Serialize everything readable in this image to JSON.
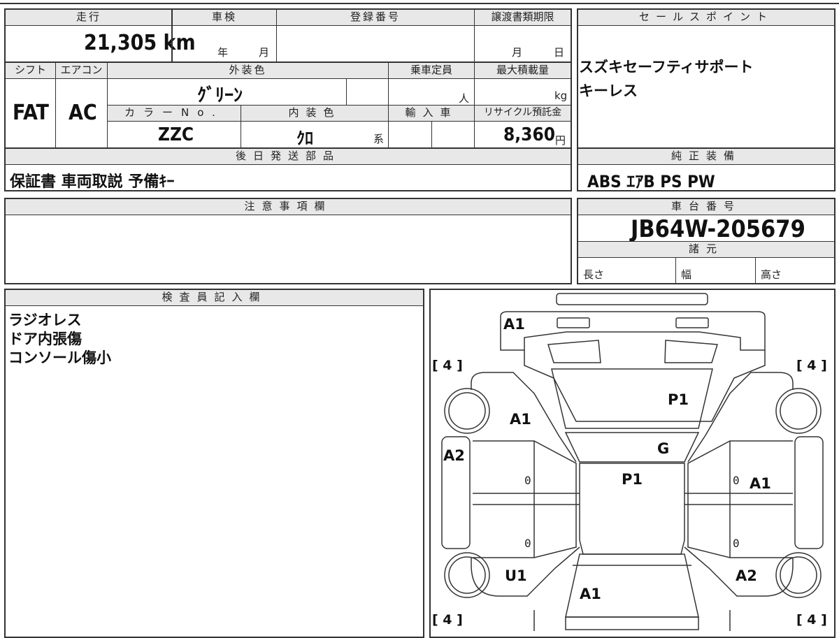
{
  "sheet": {
    "mileage_label": "走行",
    "mileage_value": "21,305 km",
    "inspection_label": "車検",
    "inspection_year": "年",
    "inspection_month": "月",
    "registration_label": "登録番号",
    "transfer_label": "譲渡書類期限",
    "transfer_month": "月",
    "transfer_day": "日",
    "shift_label": "シフト",
    "shift_value": "FAT",
    "aircon_label": "エアコン",
    "aircon_value": "AC",
    "exterior_label": "外装色",
    "exterior_value": "ｸﾞﾘｰﾝ",
    "capacity_label": "乗車定員",
    "capacity_unit": "人",
    "maxload_label": "最大積載量",
    "maxload_unit": "kg",
    "colorno_label": "カラーNo.",
    "colorno_value": "ZZC",
    "interior_label": "内装色",
    "interior_value": "ｸﾛ",
    "interior_suffix": "系",
    "import_label": "輸入車",
    "recycle_label": "リサイクル預託金",
    "recycle_value": "8,360",
    "recycle_unit": "円",
    "later_label": "後日発送部品",
    "later_value": "保証書 車両取説 予備ｷｰ",
    "sales_label": "セールスポイント",
    "sales_lines": [
      "スズキセーフティサポート",
      "キーレス"
    ],
    "equipment_label": "純正装備",
    "equipment_value": "ABS ｴｱB PS PW",
    "notes_label": "注意事項欄",
    "chassis_label": "車台番号",
    "chassis_value": "JB64W-205679",
    "specs_label": "諸元",
    "length_label": "長さ",
    "width_label": "幅",
    "height_label": "高さ",
    "inspector_label": "検査員記入欄",
    "inspector_lines": [
      "ラジオレス",
      "ドア内張傷",
      "コンソール傷小"
    ]
  },
  "diagram": {
    "tire_tl": "[ 4 ]",
    "tire_tr": "[ 4 ]",
    "tire_bl": "[ 4 ]",
    "tire_br": "[ 4 ]",
    "marks": {
      "front_bumper": "A1",
      "hood": "P1",
      "left_front_fender": "A1",
      "windshield": "G",
      "left_front_pillar": "A2",
      "roof": "P1",
      "right_front_door": "A1",
      "left_rear_fender": "U1",
      "rear_gate": "A1",
      "right_rear_fender": "A2"
    },
    "door_zero_lf": "0",
    "door_zero_rf": "0",
    "door_zero_lr": "0",
    "door_zero_rr": "0"
  }
}
